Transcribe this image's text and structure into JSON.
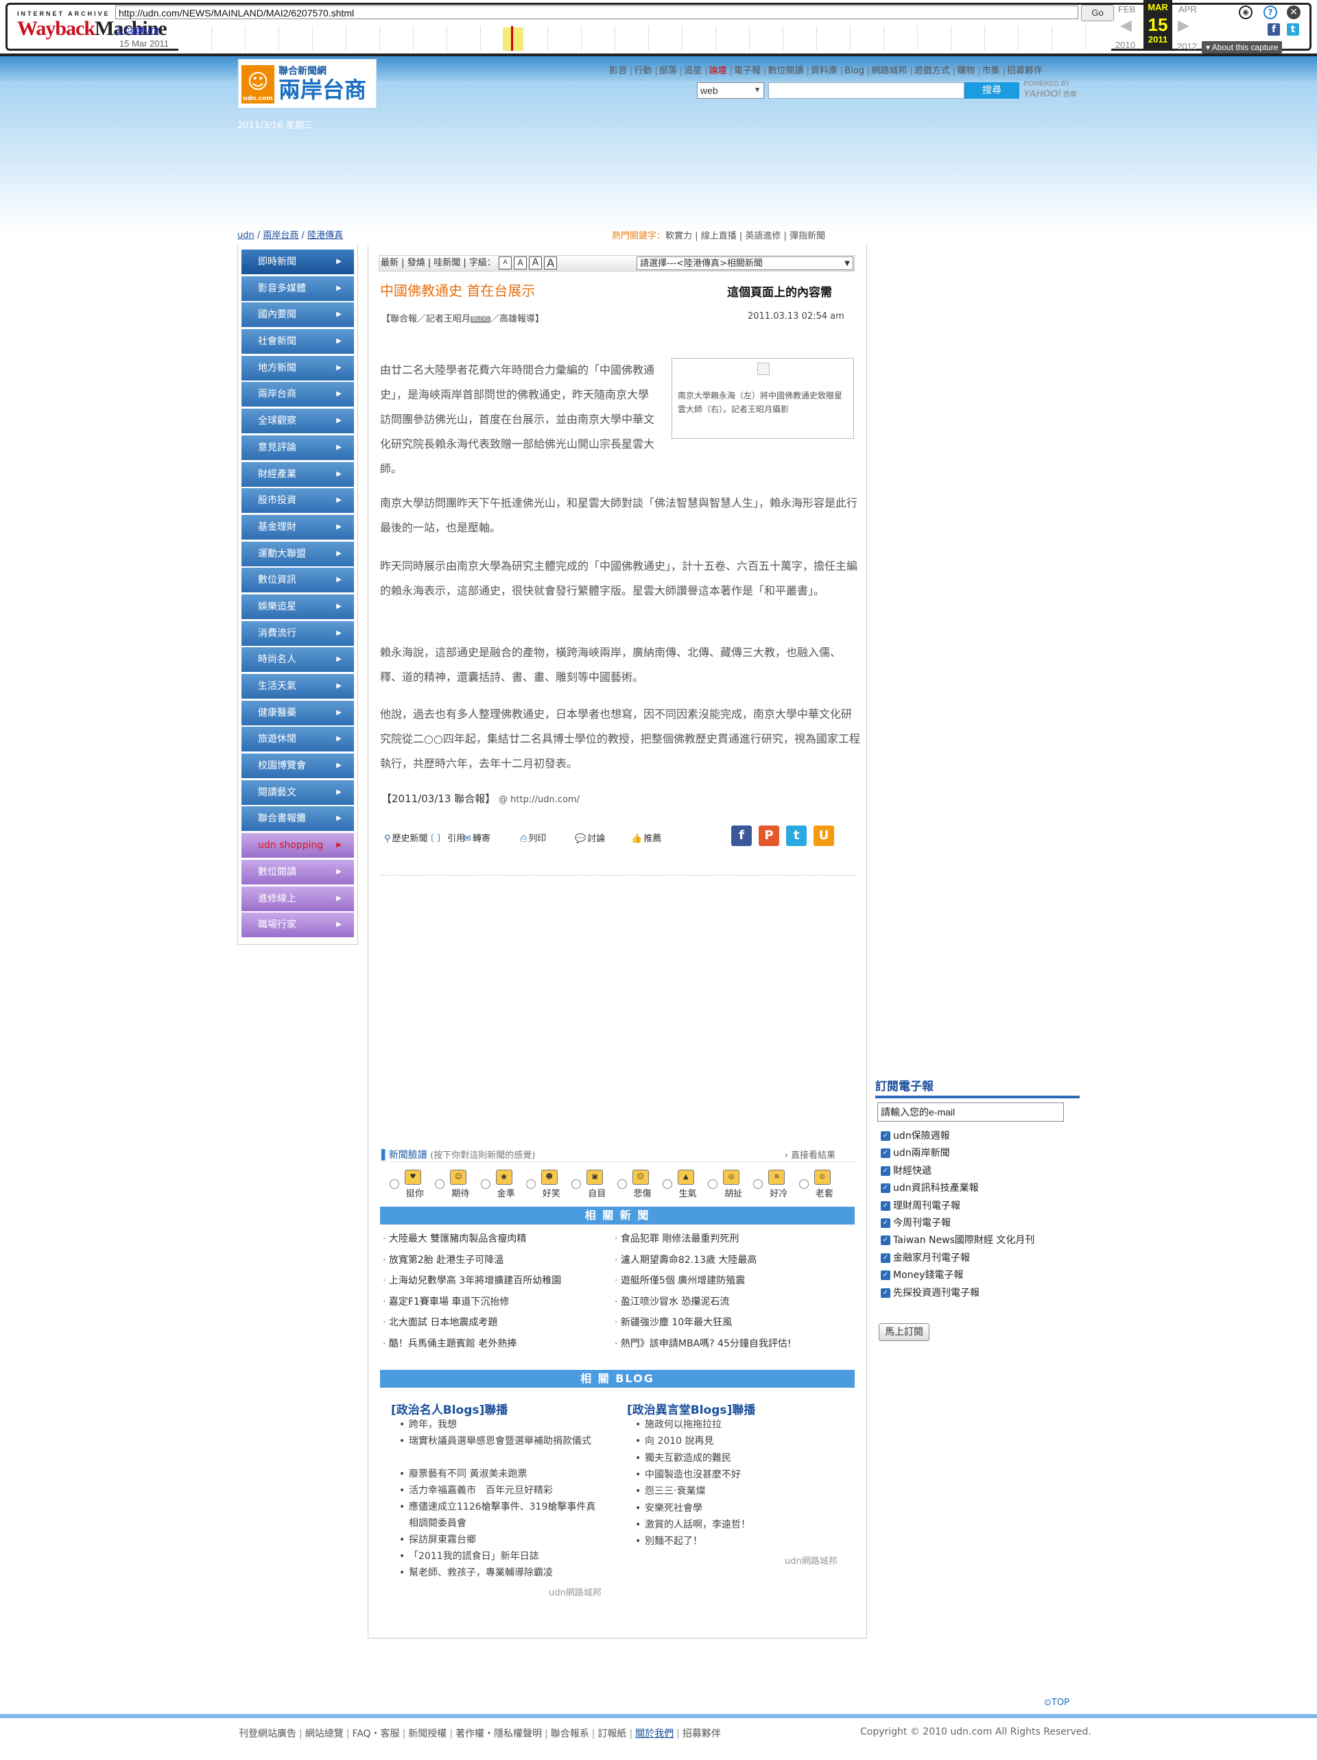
{
  "wayback": {
    "logo_top": "INTERNET ARCHIVE",
    "logo_main_a": "Wayback",
    "logo_main_b": "Machine",
    "url": "http://udn.com/NEWS/MAINLAND/MAI2/6207570.shtml",
    "go": "Go",
    "captures": "1 capture",
    "capture_date": "15 Mar 2011",
    "prev_month": "FEB",
    "cur_month": "MAR",
    "next_month": "APR",
    "prev_year": "2010",
    "cur_day": "15",
    "cur_year": "2011",
    "next_year": "2012",
    "about": "▾ About this capture"
  },
  "header": {
    "logo_line1": "聯合新聞網",
    "logo_line2": "兩岸台商",
    "logo_udn": "udn.com",
    "date": "2011/3/16 星期三",
    "nav": [
      "影音",
      "行動",
      "部落",
      "追星",
      "論壇",
      "電子報",
      "數位閱讀",
      "資料庫",
      "Blog",
      "網路城邦",
      "遊戲方式",
      "購物",
      "市集",
      "招募夥伴"
    ],
    "search_scope": "web",
    "search_button": "搜尋",
    "powered_by": "POWERED BY",
    "yahoo": "YAHOO!",
    "yahoo_sub": "奇摩"
  },
  "breadcrumb": {
    "home": "udn",
    "sep": " / ",
    "section": "兩岸台商",
    "sub": "陸港傳真"
  },
  "hot": {
    "label": "熱門關鍵字：",
    "items": [
      "軟實力",
      "線上直播",
      "英語進修",
      "彈指新聞"
    ],
    "sep": " | "
  },
  "left_nav": [
    {
      "label": "即時新聞",
      "style": "first"
    },
    {
      "label": "影音多媒體"
    },
    {
      "label": "國內要聞"
    },
    {
      "label": "社會新聞"
    },
    {
      "label": "地方新聞"
    },
    {
      "label": "兩岸台商"
    },
    {
      "label": "全球觀察"
    },
    {
      "label": "意見評論"
    },
    {
      "label": "財經產業"
    },
    {
      "label": "股市投資"
    },
    {
      "label": "基金理財"
    },
    {
      "label": "運動大聯盟"
    },
    {
      "label": "數位資訊"
    },
    {
      "label": "娛樂追星"
    },
    {
      "label": "消費流行"
    },
    {
      "label": "時尚名人"
    },
    {
      "label": "生活天氣"
    },
    {
      "label": "健康醫藥"
    },
    {
      "label": "旅遊休閒"
    },
    {
      "label": "校園博覽會"
    },
    {
      "label": "閱讀藝文"
    },
    {
      "label": "聯合書報攤"
    },
    {
      "label": "udn shopping",
      "style": "pur shop"
    },
    {
      "label": "數位閱讀",
      "style": "pur"
    },
    {
      "label": "進修線上",
      "style": "pur"
    },
    {
      "label": "職場行家",
      "style": "pur"
    }
  ],
  "toolbar": {
    "items": "最新 | 發燒 | 哇新聞 | 字級：",
    "related_select": "請選擇---<陸港傳真>相關新聞"
  },
  "article": {
    "title": "中國佛教通史 首在台展示",
    "note": "這個頁面上的內容需",
    "byline_a": "【聯合報／記者王昭月",
    "byline_blog": "BLOG",
    "byline_b": "／高雄報導】",
    "time": "2011.03.13 02:54 am",
    "photo_caption": "南京大學賴永海（左）將中國佛教通史致贈星雲大師（右）。記者王昭月攝影",
    "p1": "由廿二名大陸學者花費六年時間合力彙編的「中國佛教通史」，是海峽兩岸首部問世的佛教通史，昨天隨南京大學訪問團參訪佛光山，首度在台展示，並由南京大學中華文化研究院長賴永海代表致贈一部給佛光山開山宗長星雲大師。",
    "p2": "南京大學訪問團昨天下午抵達佛光山，和星雲大師對談「佛法智慧與智慧人生」，賴永海形容是此行最後的一站，也是壓軸。",
    "p3": "昨天同時展示由南京大學為研究主體完成的「中國佛教通史」，計十五卷、六百五十萬字，擔任主編的賴永海表示，這部通史，很快就會發行繁體字版。星雲大師讚譽這本著作是「和平叢書」。",
    "p4": "賴永海說，這部通史是融合的產物，橫跨海峽兩岸，廣納南傳、北傳、藏傳三大教，也融入儒、釋、道的精神，還囊括詩、書、畫、雕刻等中國藝術。",
    "p5": "他說，過去也有多人整理佛教通史，日本學者也想寫，因不同因素沒能完成，南京大學中華文化研究院從二○○四年起，集結廿二名具博士學位的教授，把整個佛教歷史貫通進行研究，視為國家工程執行，共歷時六年，去年十二月初發表。",
    "source": "【2011/03/13 聯合報】",
    "source_url": "@ http://udn.com/"
  },
  "tools": [
    "歷史新聞",
    "引用",
    "轉寄",
    "列印",
    "討論",
    "推薦"
  ],
  "social": [
    {
      "name": "facebook",
      "glyph": "f",
      "color": "#3b5998"
    },
    {
      "name": "plurk",
      "glyph": "P",
      "color": "#e5582c"
    },
    {
      "name": "twitter",
      "glyph": "t",
      "color": "#2aa9e0"
    },
    {
      "name": "udn",
      "glyph": "U",
      "color": "#f39c12"
    }
  ],
  "mood": {
    "title": "新聞臉譜",
    "hint": "(按下你對這則新聞的感覺)",
    "result": "› 直接看結果",
    "items": [
      "挺你",
      "期待",
      "金準",
      "好笑",
      "自目",
      "悲傷",
      "生氣",
      "胡扯",
      "好冷",
      "老套"
    ]
  },
  "related_news": {
    "header": "相 關 新 聞",
    "left": [
      "大陸最大 雙匯豬肉製品含瘦肉精",
      "放寬第2胎 赴港生子可降溫",
      "上海幼兒數學高 3年將增擴建百所幼稚園",
      "嘉定F1賽車場 車道下沉抬修",
      "北大面試 日本地震成考題",
      "酷！兵馬俑主題賓館 老外熱捧"
    ],
    "right": [
      "食品犯罪 剛修法最重判死刑",
      "瀘人期望壽命82.13歲 大陸最高",
      "遊艇所僅5個 廣州增建防殖震",
      "盈江喷沙冒水 恐攥泥石流",
      "新疆強沙塵 10年最大狂風",
      "熱門》該申請MBA嗎? 45分鐘自我評估!"
    ]
  },
  "related_blog": {
    "header": "相 關 BLOG",
    "left_title": "[政治名人Blogs]聯播",
    "left": [
      "跨年，我想",
      "瑞實秋議員選舉感恩會暨選舉補助捐款儀式",
      "廢票藝有不同 黃淑美未跑票",
      "活力幸福嘉義市　百年元旦好精彩",
      "應儘速成立1126槍擊事件、319槍擊事件真相調閱委員會",
      "探訪屏東霧台鄉",
      "「2011我的謊食日」新年日誌",
      "幫老師、救孩子，專業輔導除霸凌"
    ],
    "right_title": "[政治異言堂Blogs]聯播",
    "right": [
      "施政何以拖拖拉拉",
      "向 2010 說再見",
      "獨夫互歡造成的難民",
      "中國製造也沒甚麼不好",
      "怨三三‧衰業燦",
      "安樂死社會學",
      "激賞的人話啊，李遠哲！",
      "別麵不起了！"
    ],
    "credit": "udn網路城邦"
  },
  "subscribe": {
    "title": "訂閱電子報",
    "input": "請輸入您的e-mail",
    "items": [
      "udn保險週報",
      "udn兩岸新聞",
      "財經快遞",
      "udn資訊科技產業報",
      "理財周刊電子報",
      "今周刊電子報",
      "Taiwan News國際財經 文化月刊",
      "金融家月刊電子報",
      "Money錢電子報",
      "先探投資週刊電子報"
    ],
    "button": "馬上訂閱"
  },
  "footer": {
    "top": "TOP",
    "links": [
      "刊登網站廣告",
      "網站總覽",
      "FAQ・客服",
      "新聞授權",
      "著作權・隱私權聲明",
      "聯合報系",
      "訂報紙",
      "關於我們",
      "招募夥伴"
    ],
    "copyright": "Copyright © 2010 udn.com All Rights Reserved."
  }
}
